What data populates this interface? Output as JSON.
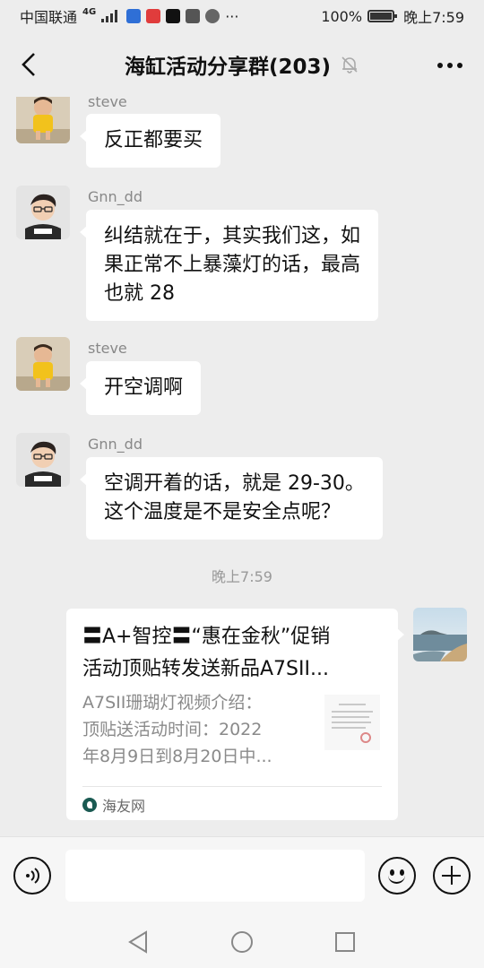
{
  "status_bar": {
    "carrier": "中国联通",
    "network": "4G",
    "battery_percent": "100%",
    "time": "晚上7:59",
    "more": "···"
  },
  "header": {
    "title": "海缸活动分享群(203)"
  },
  "messages": [
    {
      "sender": "steve",
      "text": [
        "反正都要买"
      ]
    },
    {
      "sender": "Gnn_dd",
      "text": [
        "纠结就在于，其实我们这，如",
        "果正常不上暴藻灯的话，最高",
        "也就 28"
      ]
    },
    {
      "sender": "steve",
      "text": [
        "开空调啊"
      ]
    },
    {
      "sender": "Gnn_dd",
      "text": [
        "空调开着的话，就是 29-30。",
        "这个温度是不是安全点呢？"
      ]
    }
  ],
  "timestamp": "晚上7:59",
  "share_card": {
    "title": [
      "〓A+智控〓“惠在金秋”促销",
      "活动顶贴转发送新品A7SII..."
    ],
    "description": [
      "A7SII珊瑚灯视频介绍：",
      "顶贴送活动时间：2022",
      "年8月9日到8月20日中..."
    ],
    "source": "海友网"
  },
  "input": {
    "value": "",
    "placeholder": ""
  },
  "icons": {
    "back": "back-arrow-icon",
    "mute": "bell-muted-icon",
    "more": "more-dots-icon",
    "voice": "voice-icon",
    "emoji": "emoji-icon",
    "plus": "plus-icon",
    "source": "haiyou-logo-icon"
  },
  "colors": {
    "background": "#ededed",
    "bubble": "#ffffff",
    "muted_text": "#888888"
  }
}
